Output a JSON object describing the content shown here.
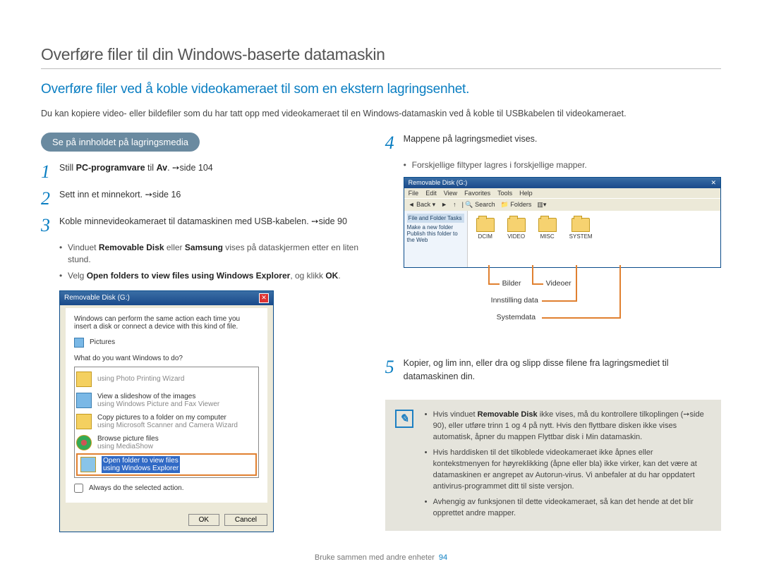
{
  "main_title": "Overføre filer til din Windows-baserte datamaskin",
  "sub_title": "Overføre filer ved å koble videokameraet til som en ekstern lagringsenhet.",
  "intro": "Du kan kopiere video- eller bildefiler som du har tatt opp med videokameraet til en Windows-datamaskin ved å koble til USBkabelen til videokameraet.",
  "pill": "Se på innholdet på lagringsmedia",
  "step1_pre": "Still ",
  "step1_b": "PC-programvare",
  "step1_mid": " til ",
  "step1_b2": "Av",
  "step1_post": ". ➙side 104",
  "step2": "Sett inn et minnekort. ➙side 16",
  "step3": "Koble minnevideokameraet til datamaskinen med USB-kabelen. ➙side 90",
  "sub3a_pre": "Vinduet ",
  "sub3a_b1": "Removable Disk",
  "sub3a_mid": " eller ",
  "sub3a_b2": "Samsung",
  "sub3a_post": " vises på dataskjermen etter en liten stund.",
  "sub3b_pre": "Velg ",
  "sub3b_b": "Open folders to view files using Windows Explorer",
  "sub3b_mid": ", og klikk ",
  "sub3b_b2": "OK",
  "sub3b_post": ".",
  "step4": "Mappene på lagringsmediet vises.",
  "sub4a": "Forskjellige filtyper lagres i forskjellige mapper.",
  "step5": "Kopier, og lim inn, eller dra og slipp disse filene fra lagringsmediet til datamaskinen din.",
  "win": {
    "title": "Removable Disk (G:)",
    "prompt": "Windows can perform the same action each time you insert a disk or connect a device with this kind of file.",
    "pictures": "Pictures",
    "q": "What do you want Windows to do?",
    "opt1": "using Photo Printing Wizard",
    "opt2a": "View a slideshow of the images",
    "opt2b": "using Windows Picture and Fax Viewer",
    "opt3a": "Copy pictures to a folder on my computer",
    "opt3b": "using Microsoft Scanner and Camera Wizard",
    "opt4a": "Browse picture files",
    "opt4b": "using MediaShow",
    "opt5a": "Open folder to view files",
    "opt5b": "using Windows Explorer",
    "always": "Always do the selected action.",
    "ok": "OK",
    "cancel": "Cancel"
  },
  "explorer": {
    "title": "Removable Disk (G:)",
    "menu": [
      "File",
      "Edit",
      "View",
      "Favorites",
      "Tools",
      "Help"
    ],
    "toolbar": [
      "Back",
      "Search",
      "Folders"
    ],
    "side1": "File and Folder Tasks",
    "side2": "Make a new folder",
    "side3": "Publish this folder to the Web",
    "folders": [
      "DCIM",
      "VIDEO",
      "MISC",
      "SYSTEM"
    ]
  },
  "callouts": {
    "l1": "Bilder",
    "l2": "Videoer",
    "l3": "Innstilling data",
    "l4": "Systemdata"
  },
  "note": {
    "n1_pre": "Hvis vinduet ",
    "n1_b": "Removable Disk",
    "n1_post": " ikke vises, må du kontrollere tilkoplingen (➙side 90), eller utføre trinn 1 og 4 på nytt. Hvis den flyttbare disken ikke vises automatisk, åpner du mappen Flyttbar disk i Min datamaskin.",
    "n2": "Hvis harddisken til det tilkoblede videokameraet ikke åpnes eller kontekstmenyen for høyreklikking (åpne eller bla) ikke virker, kan det være at datamaskinen er angrepet av Autorun-virus. Vi anbefaler at du har oppdatert antivirus-programmet ditt til siste versjon.",
    "n3": "Avhengig av funksjonen til dette videokameraet, så kan det hende at det blir opprettet andre mapper."
  },
  "footer": {
    "text": "Bruke sammen med andre enheter",
    "page": "94"
  }
}
